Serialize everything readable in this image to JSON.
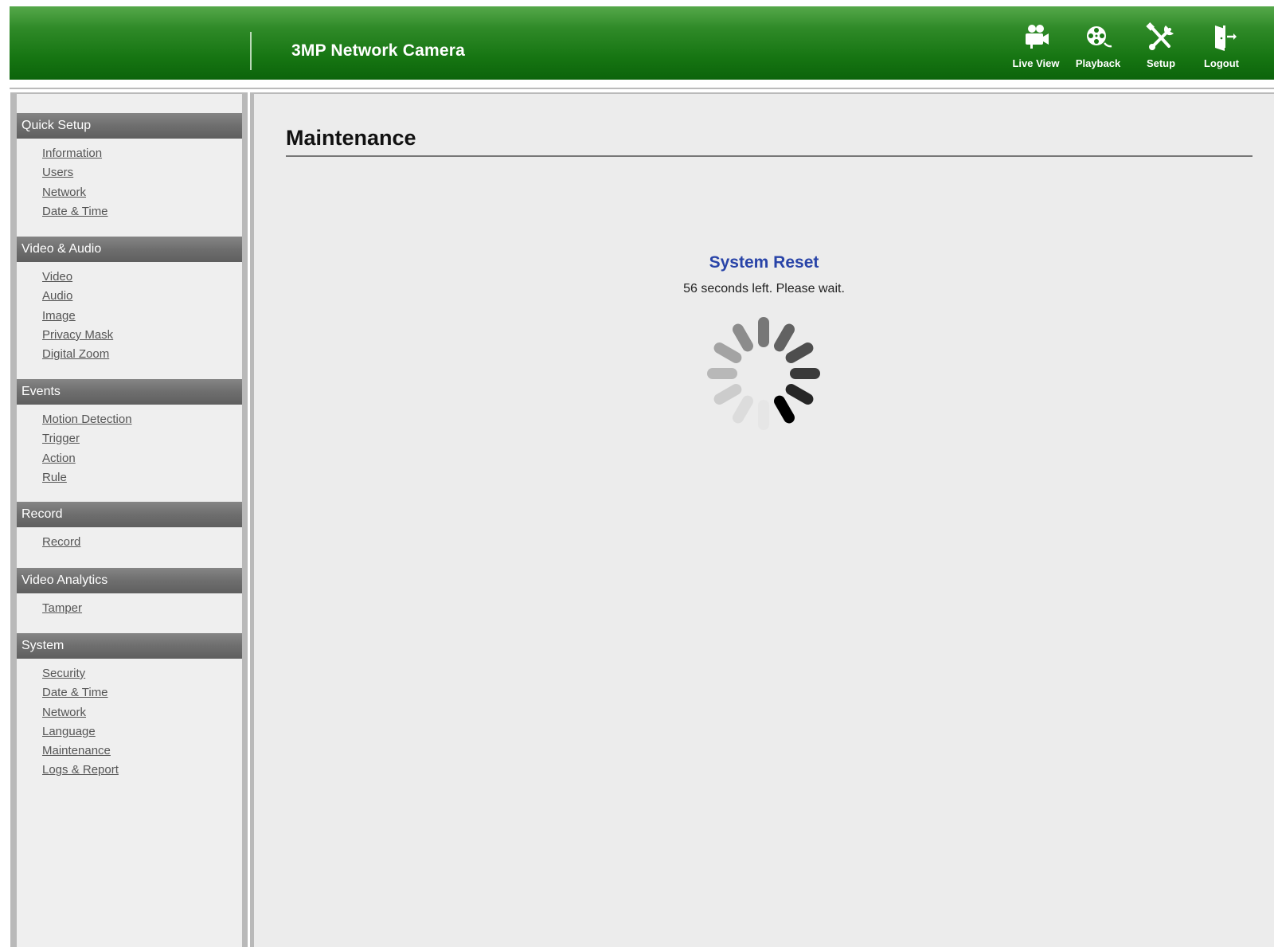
{
  "header": {
    "title": "3MP Network Camera",
    "nav": [
      {
        "label": "Live View",
        "icon": "video-camera-icon"
      },
      {
        "label": "Playback",
        "icon": "film-reel-icon"
      },
      {
        "label": "Setup",
        "icon": "wrench-screwdriver-icon"
      },
      {
        "label": "Logout",
        "icon": "door-exit-icon"
      }
    ]
  },
  "sidebar": {
    "sections": [
      {
        "title": "Quick Setup",
        "links": [
          "Information",
          "Users",
          "Network",
          "Date & Time"
        ]
      },
      {
        "title": "Video & Audio",
        "links": [
          "Video",
          "Audio",
          "Image",
          "Privacy Mask",
          "Digital Zoom"
        ]
      },
      {
        "title": "Events",
        "links": [
          "Motion Detection",
          "Trigger",
          "Action",
          "Rule"
        ]
      },
      {
        "title": "Record",
        "links": [
          "Record"
        ]
      },
      {
        "title": "Video Analytics",
        "links": [
          "Tamper"
        ]
      },
      {
        "title": "System",
        "links": [
          "Security",
          "Date & Time",
          "Network",
          "Language",
          "Maintenance",
          "Logs & Report"
        ]
      }
    ]
  },
  "main": {
    "title": "Maintenance",
    "reset_title": "System Reset",
    "reset_message": "56 seconds left. Please wait."
  },
  "colors": {
    "header_green": "#167512",
    "section_gray": "#6e6e6e",
    "reset_title_blue": "#2944a8",
    "link_gray": "#555555"
  }
}
